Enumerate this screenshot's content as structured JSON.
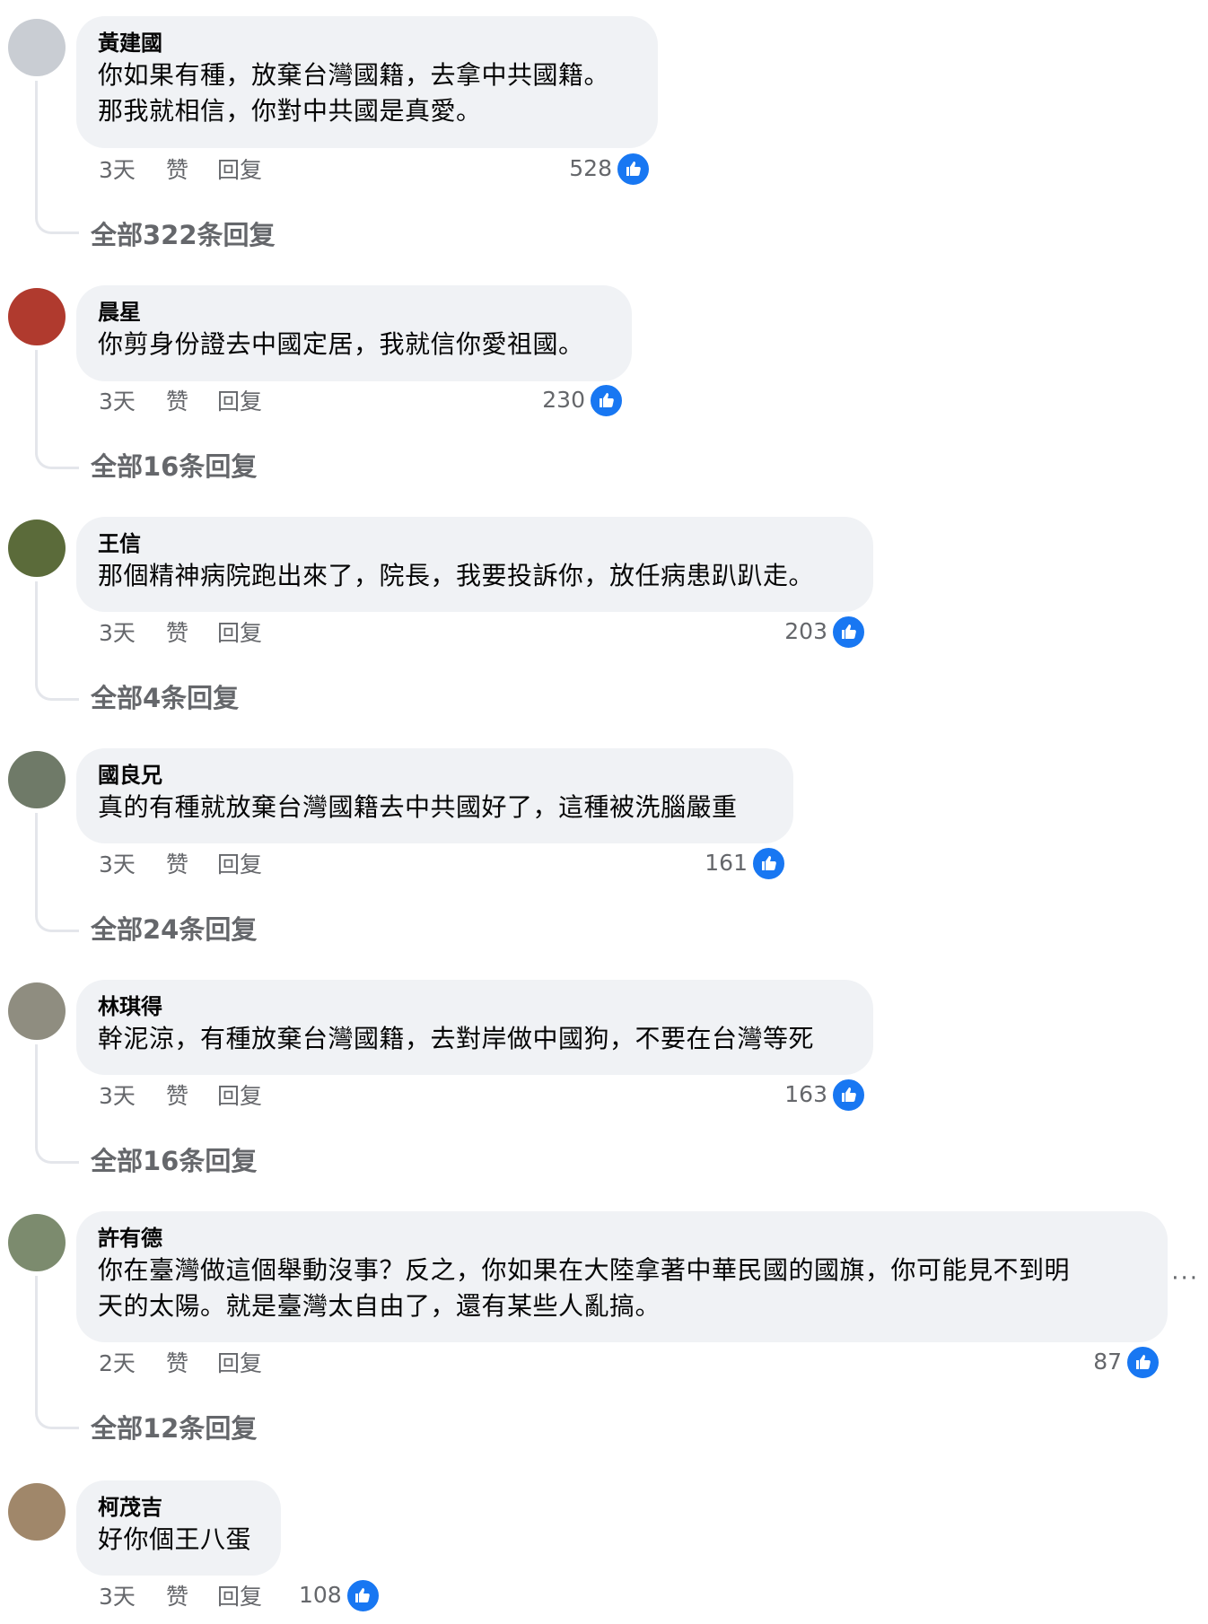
{
  "actions": {
    "like_label": "赞",
    "reply_label": "回复"
  },
  "more_label": "···",
  "comments": [
    {
      "author": "黃建國",
      "text": "你如果有種，放棄台灣國籍，去拿中共國籍。\n那我就相信，你對中共國是真愛。",
      "time": "3天",
      "likes": "528",
      "replies": "全部322条回复",
      "avatar_color": "#c9cdd3"
    },
    {
      "author": "晨星",
      "text": "你剪身份證去中國定居，我就信你愛祖國。",
      "time": "3天",
      "likes": "230",
      "replies": "全部16条回复",
      "avatar_color": "#b03a2e"
    },
    {
      "author": "王信",
      "text": "那個精神病院跑出來了，院長，我要投訴你，放任病患趴趴走。",
      "time": "3天",
      "likes": "203",
      "replies": "全部4条回复",
      "avatar_color": "#5b6b3a"
    },
    {
      "author": "國良兄",
      "text": "真的有種就放棄台灣國籍去中共國好了，這種被洗腦嚴重",
      "time": "3天",
      "likes": "161",
      "replies": "全部24条回复",
      "avatar_color": "#6f7a68"
    },
    {
      "author": "林琪得",
      "text": "幹泥涼，有種放棄台灣國籍，去對岸做中國狗，不要在台灣等死",
      "time": "3天",
      "likes": "163",
      "replies": "全部16条回复",
      "avatar_color": "#8f8d80"
    },
    {
      "author": "許有德",
      "text": "你在臺灣做這個舉動沒事？反之，你如果在大陸拿著中華民國的國旗，你可能見不到明\n天的太陽。就是臺灣太自由了，還有某些人亂搞。",
      "time": "2天",
      "likes": "87",
      "replies": "全部12条回复",
      "avatar_color": "#7c8b6e"
    },
    {
      "author": "柯茂吉",
      "text": "好你個王八蛋",
      "time": "3天",
      "likes": "108",
      "replies": "",
      "avatar_color": "#a0876a"
    }
  ]
}
